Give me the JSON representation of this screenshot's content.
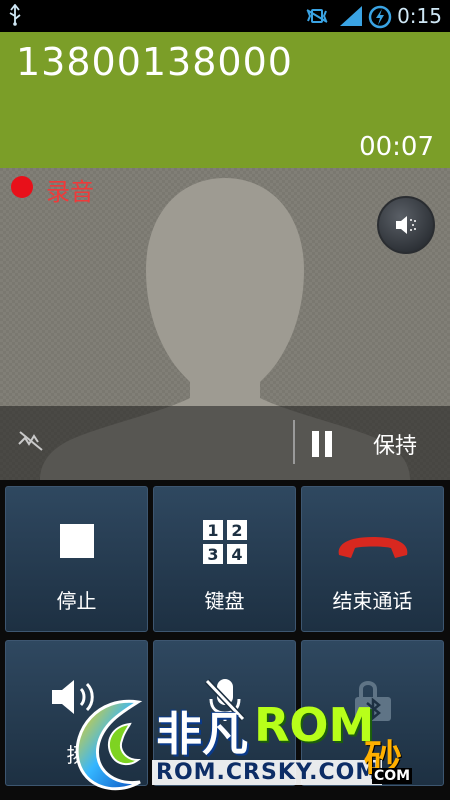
{
  "status_bar": {
    "time": "0:15",
    "icons": [
      "usb-icon",
      "vibrate-icon",
      "signal-icon",
      "battery-charging-icon"
    ]
  },
  "call": {
    "phone_number": "13800138000",
    "duration": "00:07"
  },
  "recording": {
    "label": "录音",
    "indicator_color": "#e8101a"
  },
  "hold": {
    "label": "保持"
  },
  "actions": [
    {
      "label": "停止",
      "icon": "stop-icon"
    },
    {
      "label": "键盘",
      "icon": "keypad-icon",
      "keypad_digits": [
        "1",
        "2",
        "3",
        "4"
      ]
    },
    {
      "label": "结束通话",
      "icon": "end-call-icon"
    },
    {
      "label": "扬",
      "icon": "speaker-icon"
    },
    {
      "label": "",
      "icon": "mute-mic-icon"
    },
    {
      "label": "",
      "icon": "bluetooth-icon"
    }
  ],
  "watermark": {
    "brand_part1": "非凡",
    "brand_part2": "ROM",
    "url": "ROM.CRSKY.COM",
    "side_text": "砂",
    "side_url": "COM"
  },
  "colors": {
    "header_green": "#7b9e28",
    "end_call_red": "#d8281f",
    "button_blue": "#2f4860"
  }
}
